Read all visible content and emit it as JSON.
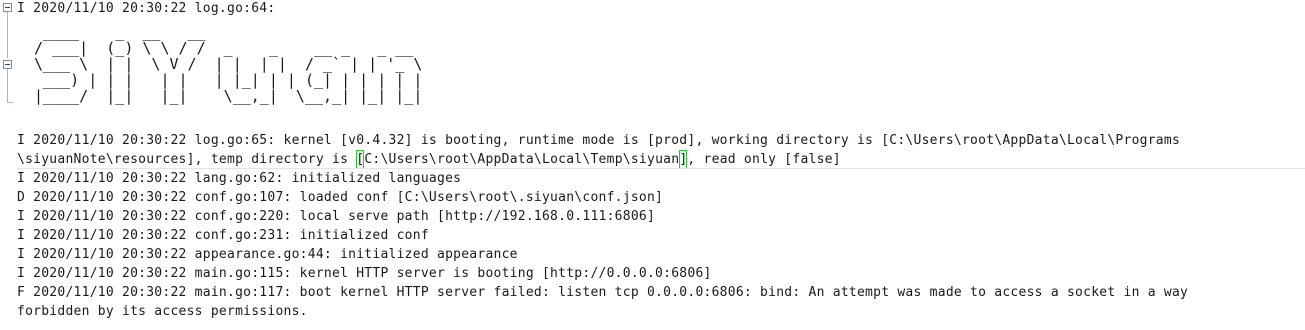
{
  "log": {
    "header_line": "I 2020/11/10 20:30:22 log.go:64:",
    "banner": "  ____    _  __   __\n / ___|  (_) \\ \\ / /  _    _    __ _   _ __\n \\___ \\  | |  \\ V /  | |  | |  / _` | | '_ \\\n  ___) | | |   | |   | |_| | | (_| | | | | |\n |____/  |_|   |_|    \\__,_|  \\__,_| |_| |_|",
    "boot_line_1": "I 2020/11/10 20:30:22 log.go:65: kernel [v0.4.32] is booting, runtime mode is [prod], working directory is [C:\\Users\\root\\AppData\\Local\\Programs",
    "boot_line_2_prefix": "\\siyuanNote\\resources], temp directory is ",
    "boot_line_2_open": "[",
    "boot_line_2_path": "C:\\Users\\root\\AppData\\Local\\Temp\\siyuan",
    "boot_line_2_close": "]",
    "boot_line_2_suffix": ", read only [false]",
    "lines": [
      "I 2020/11/10 20:30:22 lang.go:62: initialized languages",
      "D 2020/11/10 20:30:22 conf.go:107: loaded conf [C:\\Users\\root\\.siyuan\\conf.json]",
      "I 2020/11/10 20:30:22 conf.go:220: local serve path [http://192.168.0.111:6806]",
      "I 2020/11/10 20:30:22 conf.go:231: initialized conf",
      "I 2020/11/10 20:30:22 appearance.go:44: initialized appearance",
      "I 2020/11/10 20:30:22 main.go:115: kernel HTTP server is booting [http://0.0.0.0:6806]",
      "F 2020/11/10 20:30:22 main.go:117: boot kernel HTTP server failed: listen tcp 0.0.0.0:6806: bind: An attempt was made to access a socket in a way",
      "forbidden by its access permissions."
    ]
  }
}
